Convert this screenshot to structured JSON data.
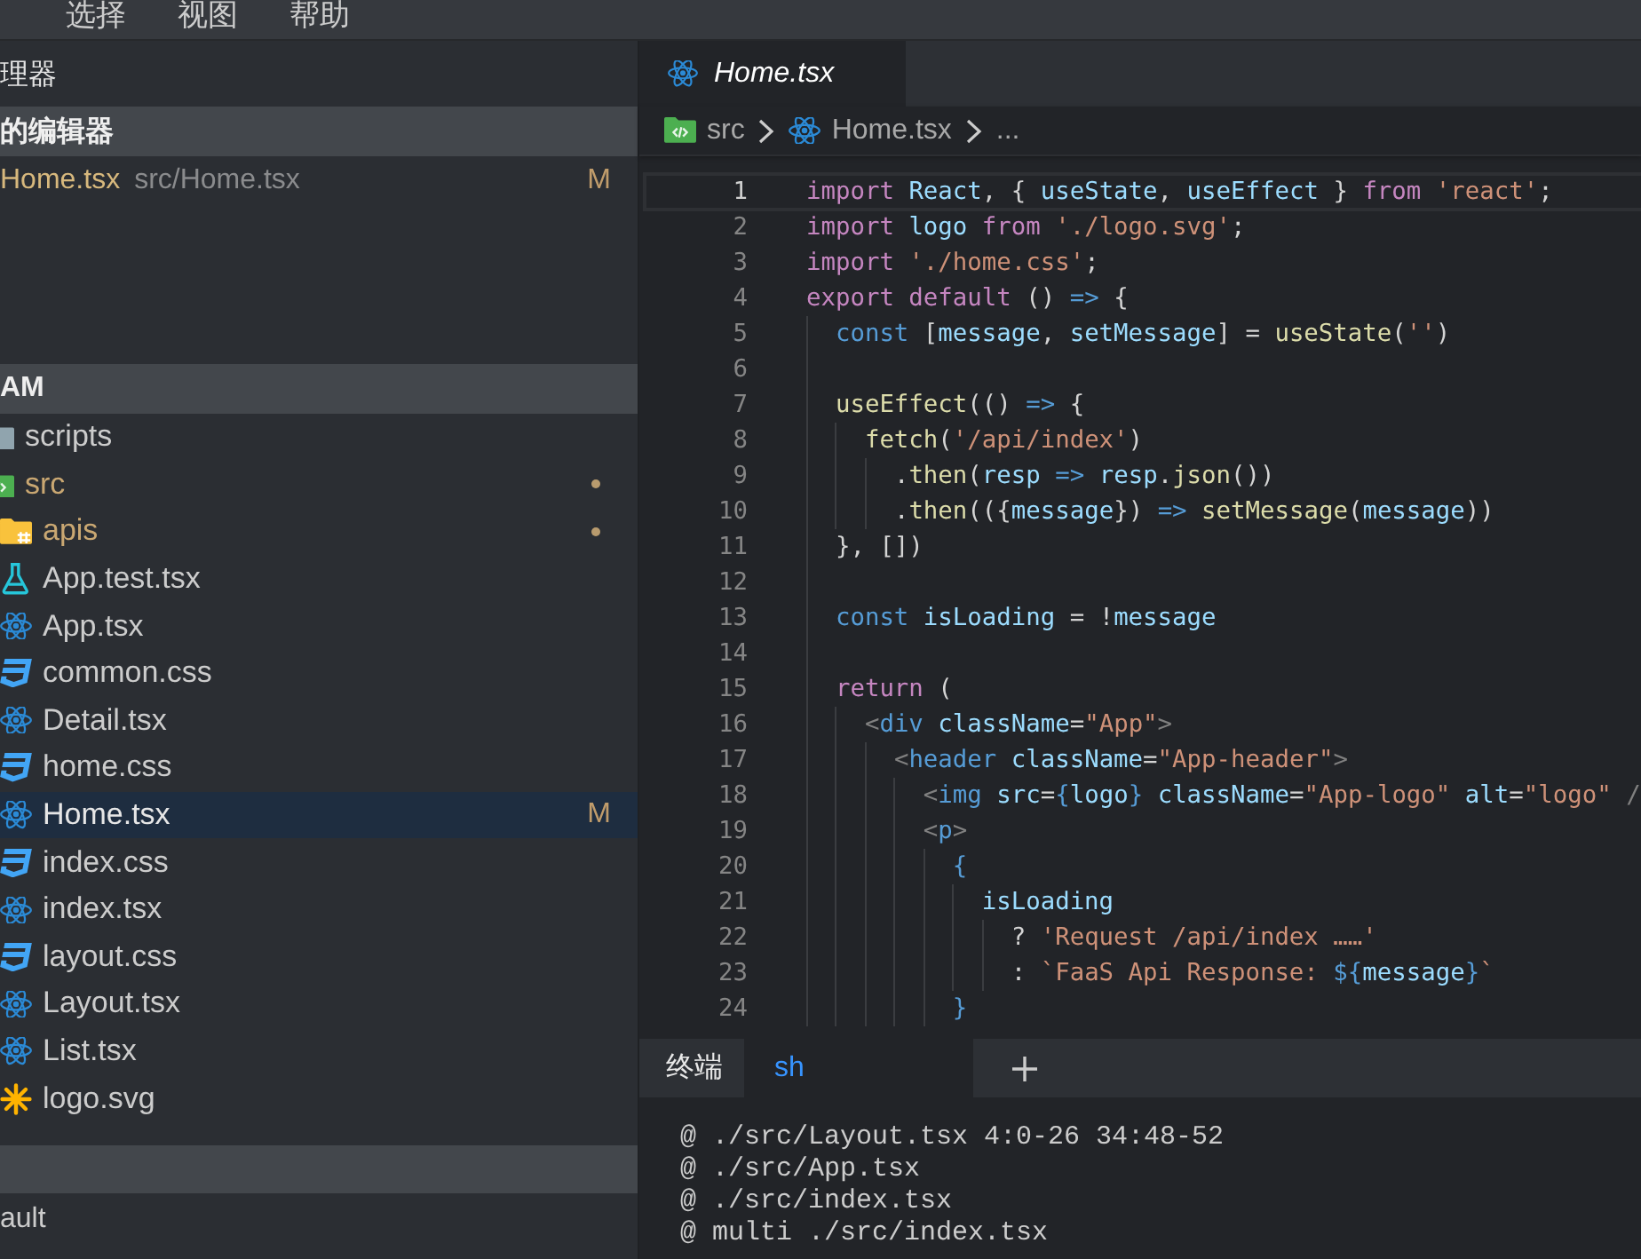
{
  "menu_bar": [
    "选择",
    "视图",
    "帮助"
  ],
  "sidebar": {
    "title": "理器",
    "open_editors": {
      "title": "的编辑器",
      "items": [
        {
          "name": "Home.tsx",
          "path": "src/Home.tsx",
          "status": "M"
        }
      ]
    },
    "explorer": {
      "title": "AM",
      "tree": [
        {
          "name": "scripts",
          "kind": "folder",
          "dot": false,
          "selected": false
        },
        {
          "name": "src",
          "kind": "folder-src",
          "dot": true,
          "selected": false,
          "children": [
            {
              "name": "apis",
              "kind": "folder-api",
              "dot": true,
              "selected": false
            },
            {
              "name": "App.test.tsx",
              "kind": "test",
              "dot": false,
              "selected": false
            },
            {
              "name": "App.tsx",
              "kind": "tsx",
              "dot": false,
              "selected": false
            },
            {
              "name": "common.css",
              "kind": "css",
              "dot": false,
              "selected": false
            },
            {
              "name": "Detail.tsx",
              "kind": "tsx",
              "dot": false,
              "selected": false
            },
            {
              "name": "home.css",
              "kind": "css",
              "dot": false,
              "selected": false
            },
            {
              "name": "Home.tsx",
              "kind": "tsx",
              "dot": false,
              "selected": true,
              "status": "M"
            },
            {
              "name": "index.css",
              "kind": "css",
              "dot": false,
              "selected": false
            },
            {
              "name": "index.tsx",
              "kind": "tsx",
              "dot": false,
              "selected": false
            },
            {
              "name": "layout.css",
              "kind": "css",
              "dot": false,
              "selected": false
            },
            {
              "name": "Layout.tsx",
              "kind": "tsx",
              "dot": false,
              "selected": false
            },
            {
              "name": "List.tsx",
              "kind": "tsx",
              "dot": false,
              "selected": false
            },
            {
              "name": "logo.svg",
              "kind": "svg",
              "dot": false,
              "selected": false
            }
          ]
        }
      ]
    },
    "section_3": {
      "items": [
        "ault"
      ]
    }
  },
  "editor": {
    "tabs": [
      {
        "label": "Home.tsx",
        "kind": "tsx",
        "selected": true,
        "preview": true
      }
    ],
    "breadcrumbs": [
      {
        "label": "src",
        "kind": "folder-src"
      },
      {
        "label": "Home.tsx",
        "kind": "tsx"
      },
      {
        "label": "..."
      }
    ],
    "lines": [
      {
        "number": "1",
        "current": true,
        "tokens": [
          {
            "kind": "keyword",
            "text": "import "
          },
          {
            "kind": "variable",
            "text": "React"
          },
          {
            "kind": "plain",
            "text": ", { "
          },
          {
            "kind": "variable",
            "text": "useState"
          },
          {
            "kind": "plain",
            "text": ", "
          },
          {
            "kind": "variable",
            "text": "useEffect"
          },
          {
            "kind": "plain",
            "text": " } "
          },
          {
            "kind": "keyword",
            "text": "from "
          },
          {
            "kind": "string",
            "text": "'react'"
          },
          {
            "kind": "plain",
            "text": ";"
          }
        ]
      },
      {
        "number": "2",
        "current": false,
        "tokens": [
          {
            "kind": "keyword",
            "text": "import "
          },
          {
            "kind": "variable",
            "text": "logo "
          },
          {
            "kind": "keyword",
            "text": "from "
          },
          {
            "kind": "string",
            "text": "'./logo.svg'"
          },
          {
            "kind": "plain",
            "text": ";"
          }
        ]
      },
      {
        "number": "3",
        "current": false,
        "tokens": [
          {
            "kind": "keyword",
            "text": "import "
          },
          {
            "kind": "string",
            "text": "'./home.css'"
          },
          {
            "kind": "plain",
            "text": ";"
          }
        ]
      },
      {
        "number": "4",
        "current": false,
        "tokens": [
          {
            "kind": "keyword",
            "text": "export default"
          },
          {
            "kind": "plain",
            "text": " () "
          },
          {
            "kind": "storage",
            "text": "=>"
          },
          {
            "kind": "plain",
            "text": " {"
          }
        ]
      },
      {
        "number": "5",
        "current": false,
        "tokens": [
          {
            "kind": "storage",
            "text": "  const"
          },
          {
            "kind": "plain",
            "text": " ["
          },
          {
            "kind": "variable",
            "text": "message"
          },
          {
            "kind": "plain",
            "text": ", "
          },
          {
            "kind": "variable",
            "text": "setMessage"
          },
          {
            "kind": "plain",
            "text": "] = "
          },
          {
            "kind": "function",
            "text": "useState"
          },
          {
            "kind": "plain",
            "text": "("
          },
          {
            "kind": "string",
            "text": "''"
          },
          {
            "kind": "plain",
            "text": ")"
          }
        ]
      },
      {
        "number": "6",
        "current": false
      },
      {
        "number": "7",
        "current": false,
        "tokens": [
          {
            "kind": "function",
            "text": "  useEffect"
          },
          {
            "kind": "plain",
            "text": "(() "
          },
          {
            "kind": "storage",
            "text": "=>"
          },
          {
            "kind": "plain",
            "text": " {"
          }
        ]
      },
      {
        "number": "8",
        "current": false,
        "tokens": [
          {
            "kind": "function",
            "text": "    fetch"
          },
          {
            "kind": "plain",
            "text": "("
          },
          {
            "kind": "string",
            "text": "'/api/index'"
          },
          {
            "kind": "plain",
            "text": ")"
          }
        ]
      },
      {
        "number": "9",
        "current": false,
        "tokens": [
          {
            "kind": "plain",
            "text": "      ."
          },
          {
            "kind": "function",
            "text": "then"
          },
          {
            "kind": "plain",
            "text": "("
          },
          {
            "kind": "variable",
            "text": "resp "
          },
          {
            "kind": "storage",
            "text": "=> "
          },
          {
            "kind": "variable",
            "text": "resp"
          },
          {
            "kind": "plain",
            "text": "."
          },
          {
            "kind": "function",
            "text": "json"
          },
          {
            "kind": "plain",
            "text": "())"
          }
        ]
      },
      {
        "number": "10",
        "current": false,
        "tokens": [
          {
            "kind": "plain",
            "text": "      ."
          },
          {
            "kind": "function",
            "text": "then"
          },
          {
            "kind": "plain",
            "text": "(({"
          },
          {
            "kind": "variable",
            "text": "message"
          },
          {
            "kind": "plain",
            "text": "}) "
          },
          {
            "kind": "storage",
            "text": "=> "
          },
          {
            "kind": "function",
            "text": "setMessage"
          },
          {
            "kind": "plain",
            "text": "("
          },
          {
            "kind": "variable",
            "text": "message"
          },
          {
            "kind": "plain",
            "text": "))"
          }
        ]
      },
      {
        "number": "11",
        "current": false,
        "tokens": [
          {
            "kind": "plain",
            "text": "  }, [])"
          }
        ]
      },
      {
        "number": "12",
        "current": false
      },
      {
        "number": "13",
        "current": false,
        "tokens": [
          {
            "kind": "storage",
            "text": "  const "
          },
          {
            "kind": "variable",
            "text": "isLoading"
          },
          {
            "kind": "plain",
            "text": " = !"
          },
          {
            "kind": "variable",
            "text": "message"
          }
        ]
      },
      {
        "number": "14",
        "current": false
      },
      {
        "number": "15",
        "current": false,
        "tokens": [
          {
            "kind": "keyword",
            "text": "  return"
          },
          {
            "kind": "plain",
            "text": " ("
          }
        ]
      },
      {
        "number": "16",
        "current": false,
        "tokens": [
          {
            "kind": "bracket",
            "text": "    <"
          },
          {
            "kind": "tag",
            "text": "div "
          },
          {
            "kind": "variable",
            "text": "className"
          },
          {
            "kind": "plain",
            "text": "="
          },
          {
            "kind": "string",
            "text": "\"App\""
          },
          {
            "kind": "bracket",
            "text": ">"
          }
        ]
      },
      {
        "number": "17",
        "current": false,
        "tokens": [
          {
            "kind": "bracket",
            "text": "      <"
          },
          {
            "kind": "tag",
            "text": "header "
          },
          {
            "kind": "variable",
            "text": "className"
          },
          {
            "kind": "plain",
            "text": "="
          },
          {
            "kind": "string",
            "text": "\"App-header\""
          },
          {
            "kind": "bracket",
            "text": ">"
          }
        ]
      },
      {
        "number": "18",
        "current": false,
        "tokens": [
          {
            "kind": "bracket",
            "text": "        <"
          },
          {
            "kind": "tag",
            "text": "img "
          },
          {
            "kind": "variable",
            "text": "src"
          },
          {
            "kind": "plain",
            "text": "="
          },
          {
            "kind": "storage",
            "text": "{"
          },
          {
            "kind": "variable",
            "text": "logo"
          },
          {
            "kind": "storage",
            "text": "} "
          },
          {
            "kind": "variable",
            "text": "className"
          },
          {
            "kind": "plain",
            "text": "="
          },
          {
            "kind": "string",
            "text": "\"App-logo\" "
          },
          {
            "kind": "variable",
            "text": "alt"
          },
          {
            "kind": "plain",
            "text": "="
          },
          {
            "kind": "string",
            "text": "\"logo\" "
          },
          {
            "kind": "bracket",
            "text": "/"
          }
        ]
      },
      {
        "number": "19",
        "current": false,
        "tokens": [
          {
            "kind": "bracket",
            "text": "        <"
          },
          {
            "kind": "tag",
            "text": "p"
          },
          {
            "kind": "bracket",
            "text": ">"
          }
        ]
      },
      {
        "number": "20",
        "current": false,
        "tokens": [
          {
            "kind": "storage",
            "text": "          {"
          }
        ]
      },
      {
        "number": "21",
        "current": false,
        "tokens": [
          {
            "kind": "variable",
            "text": "            isLoading"
          }
        ]
      },
      {
        "number": "22",
        "current": false,
        "tokens": [
          {
            "kind": "plain",
            "text": "              ? "
          },
          {
            "kind": "string",
            "text": "'Request /api/index ……'"
          }
        ]
      },
      {
        "number": "23",
        "current": false,
        "tokens": [
          {
            "kind": "plain",
            "text": "              : "
          },
          {
            "kind": "string",
            "text": "`FaaS Api Response: "
          },
          {
            "kind": "storage",
            "text": "${"
          },
          {
            "kind": "variable",
            "text": "message"
          },
          {
            "kind": "storage",
            "text": "}"
          },
          {
            "kind": "string",
            "text": "`"
          }
        ]
      },
      {
        "number": "24",
        "current": false,
        "tokens": [
          {
            "kind": "storage",
            "text": "          }"
          }
        ]
      }
    ]
  },
  "terminal": {
    "title": "终端",
    "tabs": [
      {
        "label": "sh",
        "selected": true
      }
    ],
    "output": [
      "@ ./src/Layout.tsx 4:0-26 34:48-52",
      "@ ./src/App.tsx",
      "@ ./src/index.tsx",
      "@ multi ./src/index.tsx"
    ]
  }
}
